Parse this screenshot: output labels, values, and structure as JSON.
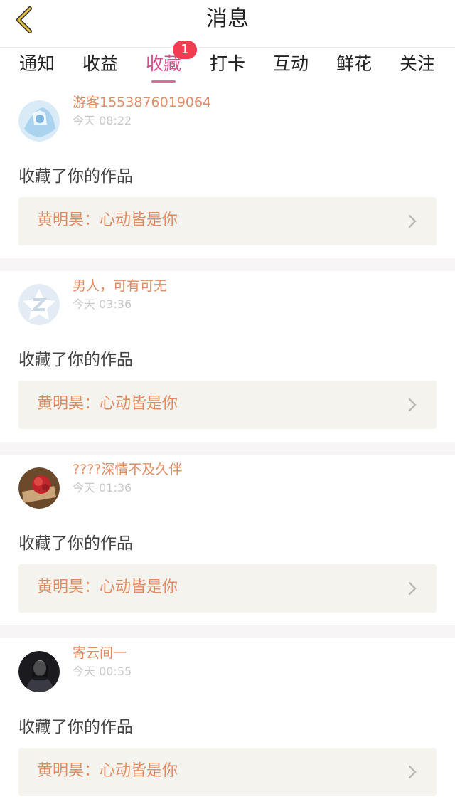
{
  "header": {
    "title": "消息",
    "back_icon": "chevron-left-icon",
    "accent": "#e3c13b"
  },
  "tabs": [
    {
      "label": "通知"
    },
    {
      "label": "收益"
    },
    {
      "label": "收藏",
      "badge": "1",
      "active": true
    },
    {
      "label": "打卡"
    },
    {
      "label": "互动"
    },
    {
      "label": "鲜花"
    },
    {
      "label": "关注"
    }
  ],
  "colors": {
    "active_tab": "#d4508a",
    "name": "#e28c63",
    "badge": "#f23c50"
  },
  "items": [
    {
      "name": "游客1553876019064",
      "time": "今天 08:22",
      "action": "收藏了你的作品",
      "work": "黄明昊：心动皆是你",
      "avatar": "anime-avatar"
    },
    {
      "name": "男人，可有可无",
      "time": "今天 03:36",
      "action": "收藏了你的作品",
      "work": "黄明昊：心动皆是你",
      "avatar": "default-avatar"
    },
    {
      "name": "????深情不及久伴",
      "time": "今天 01:36",
      "action": "收藏了你的作品",
      "work": "黄明昊：心动皆是你",
      "avatar": "rose-avatar"
    },
    {
      "name": "寄云间一",
      "time": "今天 00:55",
      "action": "收藏了你的作品",
      "work": "黄明昊：心动皆是你",
      "avatar": "portrait-avatar"
    }
  ]
}
